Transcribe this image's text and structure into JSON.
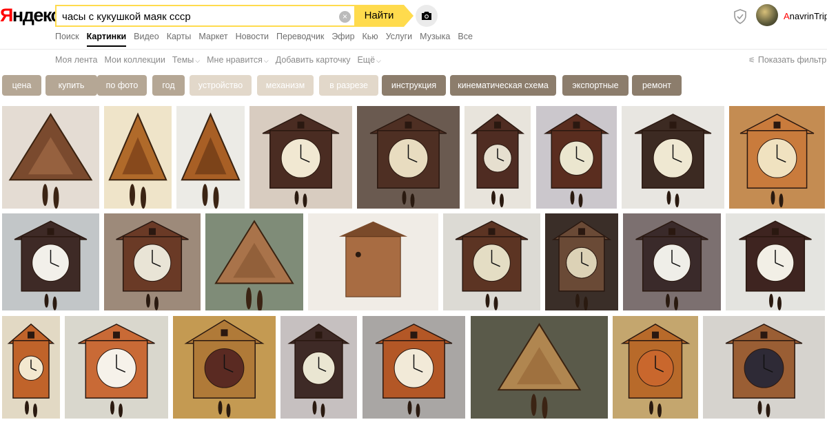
{
  "header": {
    "logo_first": "Я",
    "logo_rest": "ндекс",
    "search_value": "часы с кукушкой маяк ссср",
    "search_button": "Найти",
    "clear_glyph": "×",
    "camera_icon": "camera-icon",
    "shield_icon": "shield-icon",
    "user_first": "A",
    "user_rest": "navrinTrip"
  },
  "tabs": [
    {
      "label": "Поиск",
      "active": false
    },
    {
      "label": "Картинки",
      "active": true
    },
    {
      "label": "Видео",
      "active": false
    },
    {
      "label": "Карты",
      "active": false
    },
    {
      "label": "Маркет",
      "active": false
    },
    {
      "label": "Новости",
      "active": false
    },
    {
      "label": "Переводчик",
      "active": false
    },
    {
      "label": "Эфир",
      "active": false
    },
    {
      "label": "Кью",
      "active": false
    },
    {
      "label": "Услуги",
      "active": false
    },
    {
      "label": "Музыка",
      "active": false
    },
    {
      "label": "Все",
      "active": false
    }
  ],
  "subnav": {
    "items": [
      {
        "label": "Моя лента",
        "dropdown": false
      },
      {
        "label": "Мои коллекции",
        "dropdown": false
      },
      {
        "label": "Темы",
        "dropdown": true
      },
      {
        "label": "Мне нравится",
        "dropdown": true
      },
      {
        "label": "Добавить карточку",
        "dropdown": false
      },
      {
        "label": "Ещё",
        "dropdown": true
      }
    ],
    "caret": "⌵",
    "filters_label": "Показать фильтры",
    "filters_icon": "sliders-icon"
  },
  "chips": [
    {
      "label": "цена",
      "color": "#b5a795"
    },
    {
      "label": "купить",
      "color": "#b5a795"
    },
    {
      "label": "по фото",
      "color": "#b5a795"
    },
    {
      "label": "год",
      "color": "#b5a795"
    },
    {
      "label": "устройство",
      "color": "#e2d8ca"
    },
    {
      "label": "механизм",
      "color": "#e2d8ca"
    },
    {
      "label": "в разрезе",
      "color": "#e2d8ca"
    },
    {
      "label": "инструкция",
      "color": "#8c7d6c"
    },
    {
      "label": "кинематическая схема",
      "color": "#8c7d6c"
    },
    {
      "label": "экспортные",
      "color": "#8c7d6c"
    },
    {
      "label": "ремонт",
      "color": "#8c7d6c"
    }
  ],
  "colors": {
    "accent_yellow": "#ffdb4d",
    "logo_red": "#ff0000"
  },
  "images": [
    {
      "shape": "triangle",
      "bg": "#e4dcd3",
      "body": "#7a4a2e",
      "dial": "#a06a45"
    },
    {
      "shape": "triangle",
      "bg": "#efe4c9",
      "body": "#b06a2a",
      "dial": "#7a3f18"
    },
    {
      "shape": "triangle",
      "bg": "#ecebe6",
      "body": "#a85f25",
      "dial": "#6d3a15"
    },
    {
      "shape": "house",
      "bg": "#d8ccc0",
      "body": "#4a2c22",
      "dial": "#f1e8d2"
    },
    {
      "shape": "house",
      "bg": "#6a5a50",
      "body": "#4e2f23",
      "dial": "#e8dcc0"
    },
    {
      "shape": "house",
      "bg": "#e8e4dc",
      "body": "#4f2c22",
      "dial": "#e6dfcf"
    },
    {
      "shape": "house",
      "bg": "#cbc7cc",
      "body": "#5a2d1f",
      "dial": "#ebe6cf"
    },
    {
      "shape": "house",
      "bg": "#e8e6e1",
      "body": "#3c2a22",
      "dial": "#efe8d2"
    },
    {
      "shape": "house",
      "bg": "#c48c52",
      "body": "#c97b3c",
      "dial": "#f0e2c0"
    },
    {
      "shape": "house",
      "bg": "#c2c6c8",
      "body": "#3e2a26",
      "dial": "#f2f0ea"
    },
    {
      "shape": "house",
      "bg": "#9d8a7a",
      "body": "#6a3a26",
      "dial": "#e9e4d6"
    },
    {
      "shape": "triangle",
      "bg": "#7f8c78",
      "body": "#a9734a",
      "dial": "#8b5a35"
    },
    {
      "shape": "box",
      "bg": "#f0ece6",
      "body": "#a86c42",
      "dial": "#7a4a2a"
    },
    {
      "shape": "house",
      "bg": "#dcdad4",
      "body": "#5c3423",
      "dial": "#e4ddc4"
    },
    {
      "shape": "house",
      "bg": "#3a2e28",
      "body": "#6a4a36",
      "dial": "#dcd2b6"
    },
    {
      "shape": "house",
      "bg": "#7c7070",
      "body": "#3a2a2a",
      "dial": "#efeee8"
    },
    {
      "shape": "house",
      "bg": "#e4e4e0",
      "body": "#3e2420",
      "dial": "#f2efe6"
    },
    {
      "shape": "house",
      "bg": "#e2d9c4",
      "body": "#c0632a",
      "dial": "#f3e8cf"
    },
    {
      "shape": "house",
      "bg": "#d9d7cd",
      "body": "#c96a36",
      "dial": "#f6f2ea"
    },
    {
      "shape": "carved",
      "bg": "#c49a52",
      "body": "#b07a38",
      "dial": "#5a2a22"
    },
    {
      "shape": "house",
      "bg": "#c6c0c0",
      "body": "#3e2a26",
      "dial": "#eae6d2"
    },
    {
      "shape": "house",
      "bg": "#a9a6a4",
      "body": "#b35726",
      "dial": "#f2ead8"
    },
    {
      "shape": "triangle",
      "bg": "#5a5a4a",
      "body": "#b08650",
      "dial": "#9a6a3a"
    },
    {
      "shape": "house",
      "bg": "#c4a66e",
      "body": "#b86a2a",
      "dial": "#c9672d"
    },
    {
      "shape": "house",
      "bg": "#d6d3ce",
      "body": "#9a5e34",
      "dial": "#2e2a36"
    }
  ]
}
